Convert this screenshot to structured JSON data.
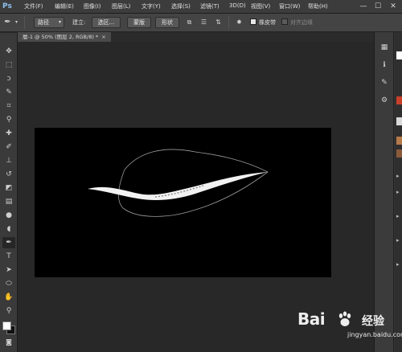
{
  "app": {
    "logo": "Ps"
  },
  "menu": {
    "items": [
      {
        "label": "文件(F)"
      },
      {
        "label": "编辑(E)"
      },
      {
        "label": "图像(I)"
      },
      {
        "label": "图层(L)"
      },
      {
        "label": "文字(Y)"
      },
      {
        "label": "选择(S)"
      },
      {
        "label": "滤镜(T)"
      },
      {
        "label": "3D(D)"
      },
      {
        "label": "视图(V)"
      },
      {
        "label": "窗口(W)"
      },
      {
        "label": "帮助(H)"
      }
    ]
  },
  "window_controls": {
    "minimize": "—",
    "maximize": "☐",
    "close": "✕"
  },
  "options_bar": {
    "mode_select": "路径",
    "build_label": "建立:",
    "selection_button": "选区...",
    "mask_button": "蒙版",
    "shape_button": "形状",
    "rubber_band_label": "橡皮带",
    "align_edges_label": "对齐边缘"
  },
  "document": {
    "tab_title": "層-1 @ 50% (图层 2, RGB/8) *",
    "close": "×"
  },
  "colors": {
    "foreground": "#ffffff",
    "background": "#111111",
    "canvas": "#000000"
  },
  "watermark": {
    "brand": "Bai",
    "brand_tail": "经验",
    "url": "jingyan.baidu.com"
  }
}
